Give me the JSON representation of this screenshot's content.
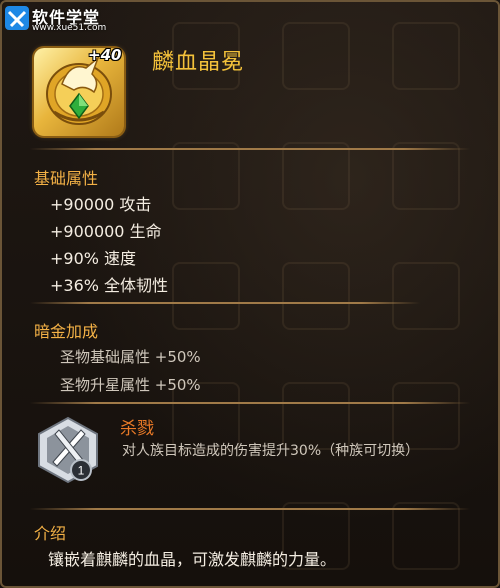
{
  "watermark": {
    "site_name": "软件学堂",
    "url": "www.xue51.com"
  },
  "item": {
    "name": "麟血晶冕",
    "level_badge": "+40",
    "icon": "golden-unicorn-crest-icon"
  },
  "base_attributes": {
    "heading": "基础属性",
    "stats": [
      "+90000 攻击",
      "+900000 生命",
      "+90% 速度",
      "+36% 全体韧性"
    ]
  },
  "dark_gold": {
    "heading": "暗金加成",
    "lines": [
      "圣物基础属性 +50%",
      "圣物升星属性 +50%"
    ]
  },
  "skill": {
    "name": "杀戮",
    "level": "1",
    "icon": "crossed-blades-skill-icon",
    "description": "对人族目标造成的伤害提升30%（种族可切换）"
  },
  "intro": {
    "heading": "介绍",
    "text": "镶嵌着麒麟的血晶，可激发麒麟的力量。"
  },
  "colors": {
    "title": "#f3c13a",
    "section_heading": "#f3b146",
    "skill_name": "#ea7a27",
    "stat_text": "#f4ede2",
    "panel_border": "#6b5537"
  }
}
